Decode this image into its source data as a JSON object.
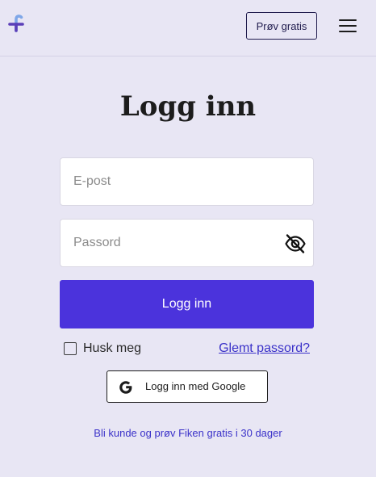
{
  "header": {
    "logo_icon": "fiken-logo-icon",
    "try_button_label": "Prøv gratis",
    "menu_icon": "hamburger-menu-icon"
  },
  "login": {
    "title": "Logg inn",
    "email_placeholder": "E-post",
    "email_value": "",
    "password_placeholder": "Passord",
    "password_value": "",
    "password_toggle_icon": "eye-slash-icon",
    "submit_label": "Logg inn",
    "remember_label": "Husk meg",
    "remember_checked": false,
    "forgot_label": "Glemt passord?",
    "google_label": "Logg inn med Google",
    "google_icon": "google-icon",
    "signup_text": "Bli kunde og prøv Fiken gratis i 30 dager"
  },
  "colors": {
    "background": "#e8e6f4",
    "primary": "#4b33dc",
    "link": "#3b32c9",
    "text": "#1c1c1c"
  }
}
